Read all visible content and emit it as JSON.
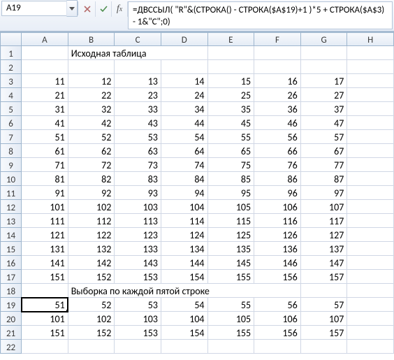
{
  "name_box": "A19",
  "formula": "=ДВССЫЛ( \"R\"&(СТРОКА() - СТРОКА($A$19)+1 )*5 + СТРОКА($A$3) - 1&\"C\";0)",
  "columns": [
    "A",
    "B",
    "C",
    "D",
    "E",
    "F",
    "G",
    "H"
  ],
  "active_cell": {
    "row": 19,
    "col": "A"
  },
  "rows": [
    {
      "n": 1,
      "cells": {
        "B": {
          "v": "Исходная таблица",
          "t": "txt",
          "span": 3
        }
      }
    },
    {
      "n": 2,
      "cells": {}
    },
    {
      "n": 3,
      "cells": {
        "A": {
          "v": "11"
        },
        "B": {
          "v": "12"
        },
        "C": {
          "v": "13"
        },
        "D": {
          "v": "14"
        },
        "E": {
          "v": "15"
        },
        "F": {
          "v": "16"
        },
        "G": {
          "v": "17"
        }
      }
    },
    {
      "n": 4,
      "cells": {
        "A": {
          "v": "21"
        },
        "B": {
          "v": "22"
        },
        "C": {
          "v": "23"
        },
        "D": {
          "v": "24"
        },
        "E": {
          "v": "25"
        },
        "F": {
          "v": "26"
        },
        "G": {
          "v": "27"
        }
      }
    },
    {
      "n": 5,
      "cells": {
        "A": {
          "v": "31"
        },
        "B": {
          "v": "32"
        },
        "C": {
          "v": "33"
        },
        "D": {
          "v": "34"
        },
        "E": {
          "v": "35"
        },
        "F": {
          "v": "36"
        },
        "G": {
          "v": "37"
        }
      }
    },
    {
      "n": 6,
      "cells": {
        "A": {
          "v": "41"
        },
        "B": {
          "v": "42"
        },
        "C": {
          "v": "43"
        },
        "D": {
          "v": "44"
        },
        "E": {
          "v": "45"
        },
        "F": {
          "v": "46"
        },
        "G": {
          "v": "47"
        }
      }
    },
    {
      "n": 7,
      "cells": {
        "A": {
          "v": "51"
        },
        "B": {
          "v": "52"
        },
        "C": {
          "v": "53"
        },
        "D": {
          "v": "54"
        },
        "E": {
          "v": "55"
        },
        "F": {
          "v": "56"
        },
        "G": {
          "v": "57"
        }
      }
    },
    {
      "n": 8,
      "cells": {
        "A": {
          "v": "61"
        },
        "B": {
          "v": "62"
        },
        "C": {
          "v": "63"
        },
        "D": {
          "v": "64"
        },
        "E": {
          "v": "65"
        },
        "F": {
          "v": "66"
        },
        "G": {
          "v": "67"
        }
      }
    },
    {
      "n": 9,
      "cells": {
        "A": {
          "v": "71"
        },
        "B": {
          "v": "72"
        },
        "C": {
          "v": "73"
        },
        "D": {
          "v": "74"
        },
        "E": {
          "v": "75"
        },
        "F": {
          "v": "76"
        },
        "G": {
          "v": "77"
        }
      }
    },
    {
      "n": 10,
      "cells": {
        "A": {
          "v": "81"
        },
        "B": {
          "v": "82"
        },
        "C": {
          "v": "83"
        },
        "D": {
          "v": "84"
        },
        "E": {
          "v": "85"
        },
        "F": {
          "v": "86"
        },
        "G": {
          "v": "87"
        }
      }
    },
    {
      "n": 11,
      "cells": {
        "A": {
          "v": "91"
        },
        "B": {
          "v": "92"
        },
        "C": {
          "v": "93"
        },
        "D": {
          "v": "94"
        },
        "E": {
          "v": "95"
        },
        "F": {
          "v": "96"
        },
        "G": {
          "v": "97"
        }
      }
    },
    {
      "n": 12,
      "cells": {
        "A": {
          "v": "101"
        },
        "B": {
          "v": "102"
        },
        "C": {
          "v": "103"
        },
        "D": {
          "v": "104"
        },
        "E": {
          "v": "105"
        },
        "F": {
          "v": "106"
        },
        "G": {
          "v": "107"
        }
      }
    },
    {
      "n": 13,
      "cells": {
        "A": {
          "v": "111"
        },
        "B": {
          "v": "112"
        },
        "C": {
          "v": "113"
        },
        "D": {
          "v": "114"
        },
        "E": {
          "v": "115"
        },
        "F": {
          "v": "116"
        },
        "G": {
          "v": "117"
        }
      }
    },
    {
      "n": 14,
      "cells": {
        "A": {
          "v": "121"
        },
        "B": {
          "v": "122"
        },
        "C": {
          "v": "123"
        },
        "D": {
          "v": "124"
        },
        "E": {
          "v": "125"
        },
        "F": {
          "v": "126"
        },
        "G": {
          "v": "127"
        }
      }
    },
    {
      "n": 15,
      "cells": {
        "A": {
          "v": "131"
        },
        "B": {
          "v": "132"
        },
        "C": {
          "v": "133"
        },
        "D": {
          "v": "134"
        },
        "E": {
          "v": "135"
        },
        "F": {
          "v": "136"
        },
        "G": {
          "v": "137"
        }
      }
    },
    {
      "n": 16,
      "cells": {
        "A": {
          "v": "141"
        },
        "B": {
          "v": "142"
        },
        "C": {
          "v": "143"
        },
        "D": {
          "v": "144"
        },
        "E": {
          "v": "145"
        },
        "F": {
          "v": "146"
        },
        "G": {
          "v": "147"
        }
      }
    },
    {
      "n": 17,
      "cells": {
        "A": {
          "v": "151"
        },
        "B": {
          "v": "152"
        },
        "C": {
          "v": "153"
        },
        "D": {
          "v": "154"
        },
        "E": {
          "v": "155"
        },
        "F": {
          "v": "156"
        },
        "G": {
          "v": "157"
        }
      }
    },
    {
      "n": 18,
      "cells": {
        "B": {
          "v": "Выборка по каждой пятой строке",
          "t": "txt",
          "span": 5
        }
      }
    },
    {
      "n": 19,
      "cells": {
        "A": {
          "v": "51"
        },
        "B": {
          "v": "52"
        },
        "C": {
          "v": "53"
        },
        "D": {
          "v": "54"
        },
        "E": {
          "v": "55"
        },
        "F": {
          "v": "56"
        },
        "G": {
          "v": "57"
        }
      }
    },
    {
      "n": 20,
      "cells": {
        "A": {
          "v": "101"
        },
        "B": {
          "v": "102"
        },
        "C": {
          "v": "103"
        },
        "D": {
          "v": "104"
        },
        "E": {
          "v": "105"
        },
        "F": {
          "v": "106"
        },
        "G": {
          "v": "107"
        }
      }
    },
    {
      "n": 21,
      "cells": {
        "A": {
          "v": "151"
        },
        "B": {
          "v": "152"
        },
        "C": {
          "v": "153"
        },
        "D": {
          "v": "154"
        },
        "E": {
          "v": "155"
        },
        "F": {
          "v": "156"
        },
        "G": {
          "v": "157"
        }
      }
    },
    {
      "n": 22,
      "cells": {}
    }
  ]
}
